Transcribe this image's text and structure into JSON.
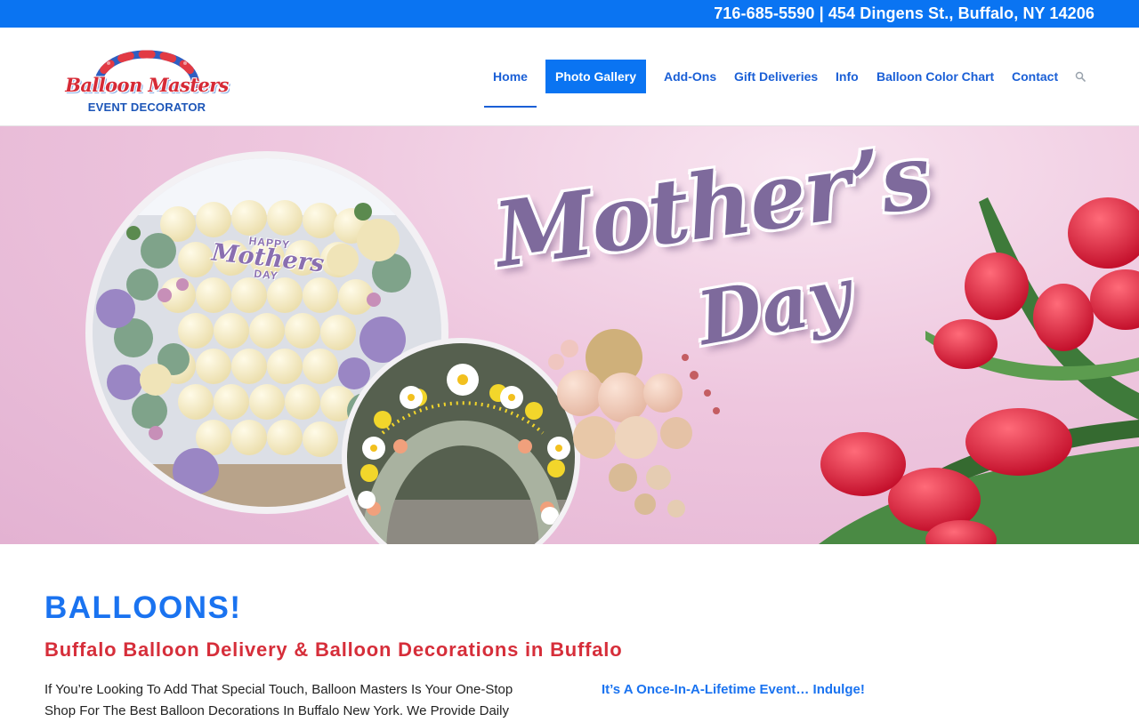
{
  "topbar": {
    "contact": "716-685-5590 | 454 Dingens St., Buffalo, NY 14206"
  },
  "logo": {
    "title": "Balloon Masters",
    "subtitle": "EVENT DECORATOR"
  },
  "nav": {
    "items": [
      {
        "label": "Home",
        "state": "current"
      },
      {
        "label": "Photo Gallery",
        "state": "highlighted"
      },
      {
        "label": "Add-Ons"
      },
      {
        "label": "Gift Deliveries"
      },
      {
        "label": "Info"
      },
      {
        "label": "Balloon Color Chart"
      },
      {
        "label": "Contact"
      }
    ],
    "search_icon": "search-icon"
  },
  "hero": {
    "title": "Mother’s",
    "subtitle": "Day",
    "sign_small": "HAPPY",
    "sign_main": "Mothers",
    "sign_last": "DAY"
  },
  "content": {
    "heading": "BALLOONS!",
    "subheading": "Buffalo Balloon Delivery & Balloon Decorations in Buffalo",
    "intro": "If You’re Looking To Add That Special Touch, Balloon Masters Is Your One-Stop Shop For The Best Balloon Decorations In Buffalo New York. We Provide Daily",
    "tagline": "It’s A Once-In-A-Lifetime Event… Indulge!"
  },
  "colors": {
    "brand_blue": "#0a74f2",
    "link_blue": "#1a5fd6",
    "heading_blue": "#1a73f0",
    "accent_red": "#d62e3a",
    "hero_pink": "#eec6de",
    "title_purple": "#7e6a9c"
  }
}
